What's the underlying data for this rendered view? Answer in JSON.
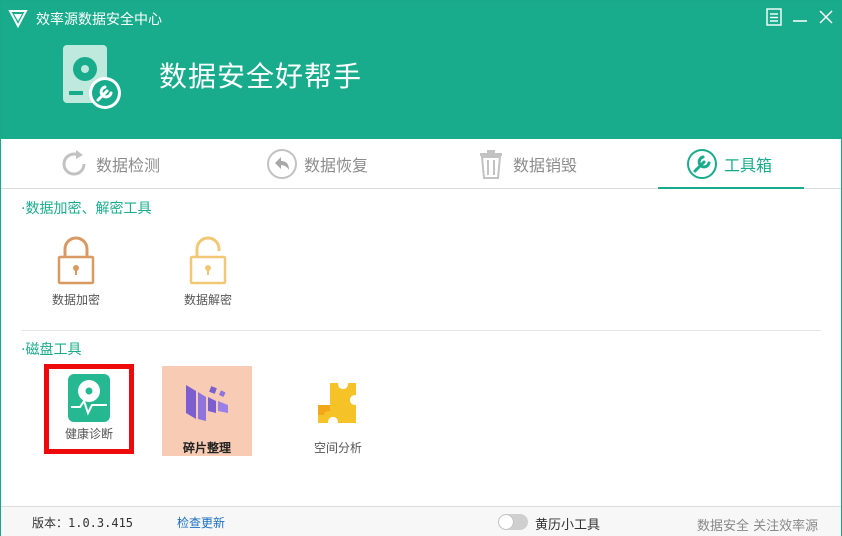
{
  "app": {
    "title": "效率源数据安全中心",
    "hero_title": "数据安全好帮手"
  },
  "tabs": [
    {
      "label": "数据检测",
      "icon": "refresh-circle-icon",
      "active": false
    },
    {
      "label": "数据恢复",
      "icon": "back-arrow-circle-icon",
      "active": false
    },
    {
      "label": "数据销毁",
      "icon": "trash-icon",
      "active": false
    },
    {
      "label": "工具箱",
      "icon": "wrench-circle-icon",
      "active": true
    }
  ],
  "sections": {
    "encryption": {
      "title": "·数据加密、解密工具",
      "tools": [
        {
          "label": "数据加密",
          "icon": "lock-closed-icon"
        },
        {
          "label": "数据解密",
          "icon": "lock-open-icon"
        }
      ]
    },
    "disk": {
      "title": "·磁盘工具",
      "tools": [
        {
          "label": "健康诊断",
          "icon": "disk-health-icon"
        },
        {
          "label": "碎片整理",
          "icon": "defrag-icon"
        },
        {
          "label": "空间分析",
          "icon": "puzzle-icon"
        }
      ]
    }
  },
  "footer": {
    "version": "版本：1.0.3.415",
    "check_update": "检查更新",
    "calendar_tool": "黄历小工具",
    "slogan": "数据安全 关注效率源"
  },
  "colors": {
    "brand": "#19ac8c",
    "highlight_red": "#ee0a0a",
    "highlight_peach": "#f8ccb4",
    "lock_closed": "#d89a62",
    "lock_open": "#f2c877",
    "defrag": "#7b5fd0",
    "puzzle": "#f5c227"
  }
}
